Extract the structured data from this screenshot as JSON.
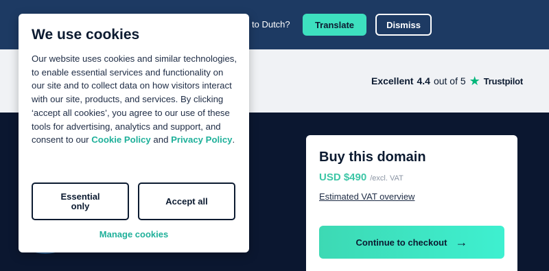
{
  "translate_bar": {
    "question": "to Dutch?",
    "translate_label": "Translate",
    "dismiss_label": "Dismiss"
  },
  "rating": {
    "rating_label": "Excellent",
    "score": "4.4",
    "scale_text": "out of 5",
    "provider": "Trustpilot",
    "star_icon": "star-icon"
  },
  "buy_card": {
    "title": "Buy this domain",
    "price": "USD $490",
    "vat_note": "/excl. VAT",
    "vat_link": "Estimated VAT overview",
    "checkout_label": "Continue to checkout",
    "arrow_icon": "arrow-right-icon"
  },
  "cookie": {
    "title": "We use cookies",
    "body_start": "Our website uses cookies and similar technologies, to enable essential services and functionality on our site and to collect data on how visitors interact with our site, products, and services. By clicking ‘accept all cookies’, you agree to our use of these tools for advertising, analytics and support, and consent to our ",
    "cookie_policy_link": "Cookie Policy",
    "and_text": " and ",
    "privacy_policy_link": "Privacy Policy",
    "period": ".",
    "essential_label": "Essential only",
    "accept_label": "Accept all",
    "manage_label": "Manage cookies"
  },
  "colors": {
    "accent": "#3de0bf",
    "header_bg": "#1d3a63",
    "hero_bg": "#0b1730",
    "link": "#1fb09a",
    "trustpilot_star": "#00b67a"
  }
}
